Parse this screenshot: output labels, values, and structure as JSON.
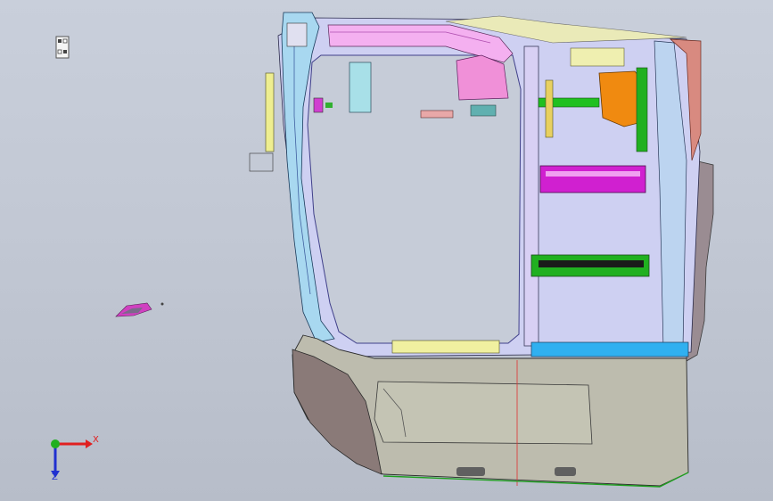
{
  "viewport": {
    "background_top": "#c9cfdb",
    "background_bottom": "#b7bdc9"
  },
  "triad": {
    "x_label": "X",
    "z_label": "Z",
    "x_color": "#e02020",
    "z_color": "#2030d0",
    "origin_color": "#20b020"
  },
  "model": {
    "panel_colors": {
      "door_skin": "#bdbcae",
      "outer_shell": "#8a7a78",
      "frame": "#c8c8f0",
      "pink_member": "#f0a0e0",
      "magenta_bar": "#e020e0",
      "green_bar": "#20c020",
      "orange_bracket": "#f08a10",
      "cyan_sill": "#30b0f0",
      "yellow_trim": "#f0f090",
      "red_edge": "#e03030"
    }
  }
}
